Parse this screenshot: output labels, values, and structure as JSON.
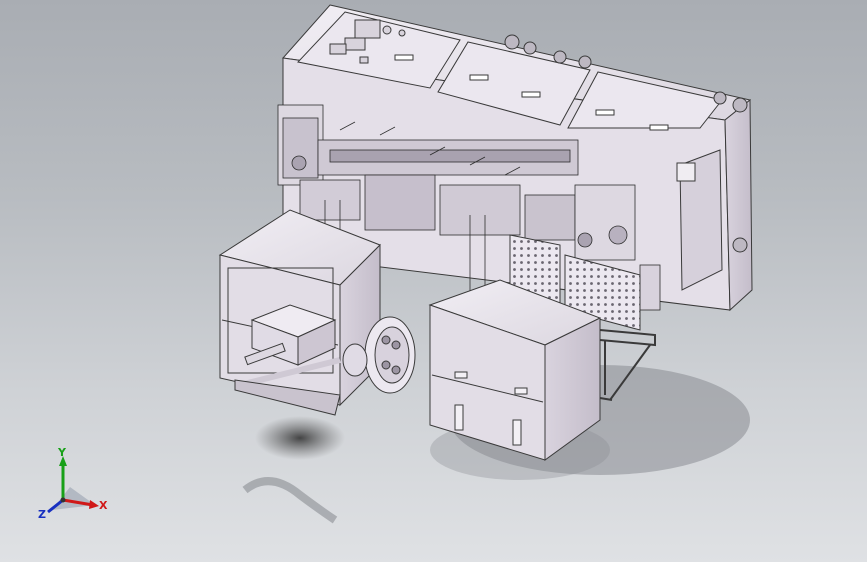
{
  "viewport": {
    "background_top": "#a9adb3",
    "background_bottom": "#dfe1e4",
    "model_color": "#e8e4ec",
    "edge_color": "#3a3a3a"
  },
  "triad": {
    "x_label": "X",
    "y_label": "Y",
    "z_label": "Z",
    "x_color": "#d01818",
    "y_color": "#18a018",
    "z_color": "#1830c0"
  }
}
